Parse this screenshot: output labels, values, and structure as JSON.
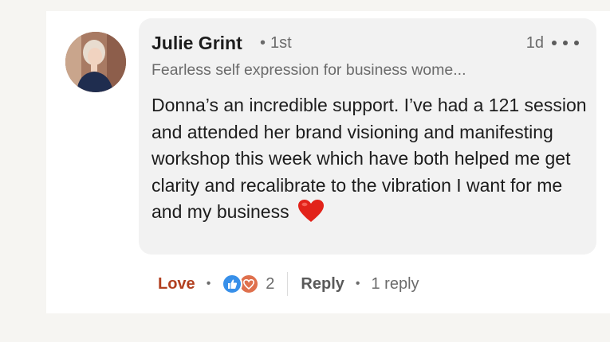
{
  "comment": {
    "author": "Julie Grint",
    "degree_separator": "•",
    "degree": "1st",
    "time": "1d",
    "headline": "Fearless self expression for business wome...",
    "text": "Donna’s an incredible support. I’ve had a 121 session and attended her brand visioning and manifesting workshop this week which have both helped me get clarity and recalibrate to the vibration I want for me and my business",
    "emoji_icon": "red-heart-emoji"
  },
  "actions": {
    "love_label": "Love",
    "dot": "•",
    "reaction_count": "2",
    "reply_label": "Reply",
    "reply_count": "1 reply"
  },
  "colors": {
    "love_accent": "#b24020",
    "like_blue": "#378fe9",
    "love_orange": "#df704d",
    "bubble_bg": "#f2f2f2",
    "heart_red": "#e2231a"
  }
}
